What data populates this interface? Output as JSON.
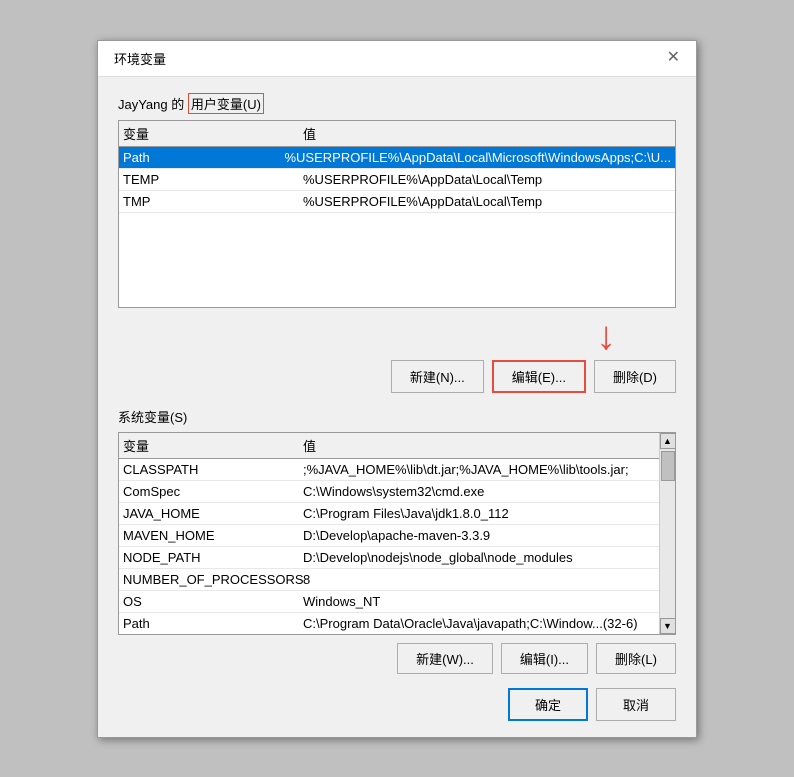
{
  "dialog": {
    "title": "环境变量",
    "close_label": "✕"
  },
  "user_section": {
    "label": "JayYang 的",
    "label2": "用户变量(U)"
  },
  "user_table": {
    "col_var": "变量",
    "col_val": "值",
    "rows": [
      {
        "var": "Path",
        "val": "%USERPROFILE%\\AppData\\Local\\Microsoft\\WindowsApps;C:\\U...",
        "selected": true
      },
      {
        "var": "TEMP",
        "val": "%USERPROFILE%\\AppData\\Local\\Temp",
        "selected": false
      },
      {
        "var": "TMP",
        "val": "%USERPROFILE%\\AppData\\Local\\Temp",
        "selected": false
      }
    ]
  },
  "user_buttons": {
    "new_label": "新建(N)...",
    "edit_label": "编辑(E)...",
    "delete_label": "删除(D)"
  },
  "sys_section": {
    "label": "系统变量(S)"
  },
  "sys_table": {
    "col_var": "变量",
    "col_val": "值",
    "rows": [
      {
        "var": "CLASSPATH",
        "val": ";%JAVA_HOME%\\lib\\dt.jar;%JAVA_HOME%\\lib\\tools.jar;"
      },
      {
        "var": "ComSpec",
        "val": "C:\\Windows\\system32\\cmd.exe"
      },
      {
        "var": "JAVA_HOME",
        "val": "C:\\Program Files\\Java\\jdk1.8.0_112"
      },
      {
        "var": "MAVEN_HOME",
        "val": "D:\\Develop\\apache-maven-3.3.9"
      },
      {
        "var": "NODE_PATH",
        "val": "D:\\Develop\\nodejs\\node_global\\node_modules"
      },
      {
        "var": "NUMBER_OF_PROCESSORS",
        "val": "8"
      },
      {
        "var": "OS",
        "val": "Windows_NT"
      },
      {
        "var": "Path",
        "val": "C:\\Program Data\\Oracle\\Java\\javapath;C:\\Window...(32-6)"
      }
    ]
  },
  "sys_buttons": {
    "new_label": "新建(W)...",
    "edit_label": "编辑(I)...",
    "delete_label": "删除(L)"
  },
  "bottom_buttons": {
    "ok_label": "确定",
    "cancel_label": "取消"
  }
}
